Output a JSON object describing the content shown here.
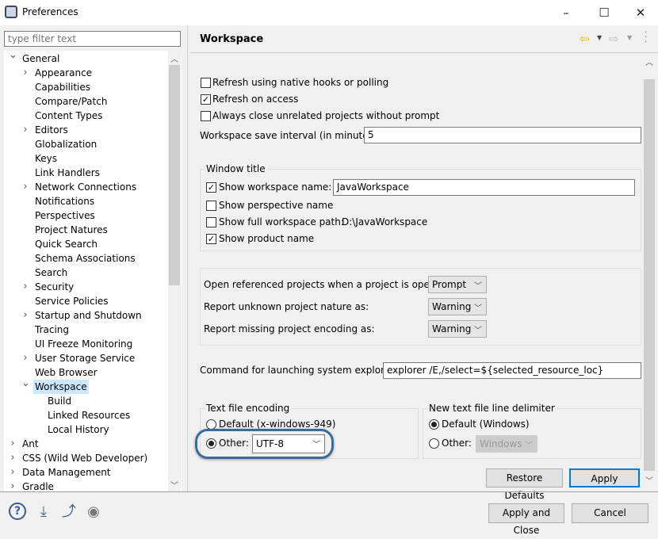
{
  "window": {
    "title": "Preferences"
  },
  "filter": {
    "placeholder": "type filter text"
  },
  "tree": [
    {
      "label": "General",
      "level": 0,
      "twisty": "open"
    },
    {
      "label": "Appearance",
      "level": 1,
      "twisty": "closed"
    },
    {
      "label": "Capabilities",
      "level": 1,
      "twisty": ""
    },
    {
      "label": "Compare/Patch",
      "level": 1,
      "twisty": ""
    },
    {
      "label": "Content Types",
      "level": 1,
      "twisty": ""
    },
    {
      "label": "Editors",
      "level": 1,
      "twisty": "closed"
    },
    {
      "label": "Globalization",
      "level": 1,
      "twisty": ""
    },
    {
      "label": "Keys",
      "level": 1,
      "twisty": ""
    },
    {
      "label": "Link Handlers",
      "level": 1,
      "twisty": ""
    },
    {
      "label": "Network Connections",
      "level": 1,
      "twisty": "closed"
    },
    {
      "label": "Notifications",
      "level": 1,
      "twisty": ""
    },
    {
      "label": "Perspectives",
      "level": 1,
      "twisty": ""
    },
    {
      "label": "Project Natures",
      "level": 1,
      "twisty": ""
    },
    {
      "label": "Quick Search",
      "level": 1,
      "twisty": ""
    },
    {
      "label": "Schema Associations",
      "level": 1,
      "twisty": ""
    },
    {
      "label": "Search",
      "level": 1,
      "twisty": ""
    },
    {
      "label": "Security",
      "level": 1,
      "twisty": "closed"
    },
    {
      "label": "Service Policies",
      "level": 1,
      "twisty": ""
    },
    {
      "label": "Startup and Shutdown",
      "level": 1,
      "twisty": "closed"
    },
    {
      "label": "Tracing",
      "level": 1,
      "twisty": ""
    },
    {
      "label": "UI Freeze Monitoring",
      "level": 1,
      "twisty": ""
    },
    {
      "label": "User Storage Service",
      "level": 1,
      "twisty": "closed"
    },
    {
      "label": "Web Browser",
      "level": 1,
      "twisty": ""
    },
    {
      "label": "Workspace",
      "level": 1,
      "twisty": "open",
      "selected": true
    },
    {
      "label": "Build",
      "level": 2,
      "twisty": ""
    },
    {
      "label": "Linked Resources",
      "level": 2,
      "twisty": ""
    },
    {
      "label": "Local History",
      "level": 2,
      "twisty": ""
    },
    {
      "label": "Ant",
      "level": 0,
      "twisty": "closed"
    },
    {
      "label": "CSS (Wild Web Developer)",
      "level": 0,
      "twisty": "closed"
    },
    {
      "label": "Data Management",
      "level": 0,
      "twisty": "closed"
    },
    {
      "label": "Gradle",
      "level": 0,
      "twisty": "closed"
    }
  ],
  "page": {
    "title": "Workspace",
    "refresh_native": {
      "label": "Refresh using native hooks or polling",
      "checked": false
    },
    "refresh_access": {
      "label": "Refresh on access",
      "checked": true
    },
    "close_unrelated": {
      "label": "Always close unrelated projects without prompt",
      "checked": false
    },
    "save_interval": {
      "label": "Workspace save interval (in minutes):",
      "value": "5"
    },
    "window_title": {
      "group": "Window title",
      "show_name": {
        "label": "Show workspace name:",
        "checked": true,
        "value": "JavaWorkspace"
      },
      "show_perspective": {
        "label": "Show perspective name",
        "checked": false
      },
      "show_path": {
        "label": "Show full workspace path:",
        "checked": false,
        "value": "D:\\JavaWorkspace"
      },
      "show_product": {
        "label": "Show product name",
        "checked": true
      }
    },
    "open_referenced": {
      "label": "Open referenced projects when a project is opened:",
      "value": "Prompt"
    },
    "unknown_nature": {
      "label": "Report unknown project nature as:",
      "value": "Warning"
    },
    "missing_encoding": {
      "label": "Report missing project encoding as:",
      "value": "Warning"
    },
    "explorer": {
      "label": "Command for launching system explorer:",
      "value": "explorer /E,/select=${selected_resource_loc}"
    },
    "encoding": {
      "group": "Text file encoding",
      "default_label": "Default (x-windows-949)",
      "other_label": "Other:",
      "selected": "other",
      "value": "UTF-8"
    },
    "delimiter": {
      "group": "New text file line delimiter",
      "default_label": "Default (Windows)",
      "other_label": "Other:",
      "selected": "default",
      "value": "Windows"
    },
    "restore_defaults": "Restore Defaults",
    "apply": "Apply"
  },
  "footer": {
    "apply_close": "Apply and Close",
    "cancel": "Cancel"
  },
  "colors": {
    "highlight_ring": "#3d6a99",
    "selection": "#cce8ff",
    "back_arrow": "#e8b400"
  }
}
